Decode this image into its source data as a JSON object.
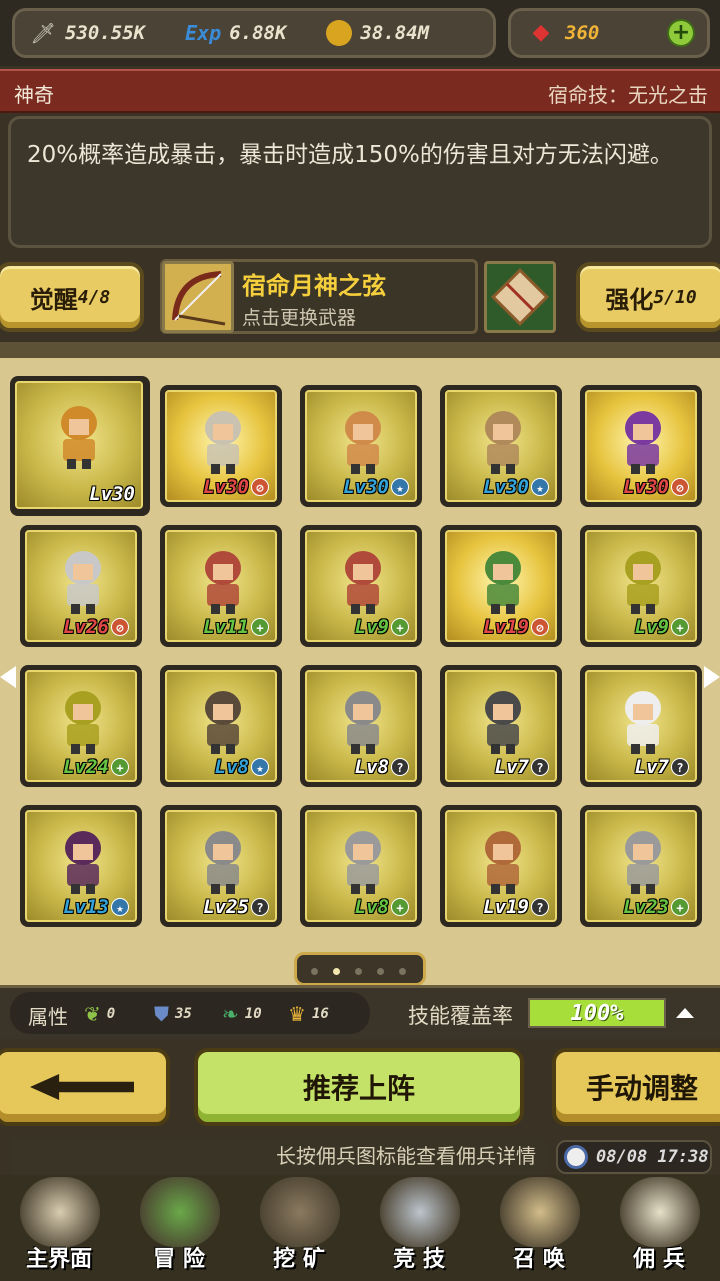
{
  "currencies": {
    "attack": {
      "icon": "sword-icon",
      "value": "530.55K"
    },
    "exp": {
      "icon": "exp-icon",
      "label": "Exp",
      "value": "6.88K"
    },
    "gold": {
      "icon": "coin-icon",
      "value": "38.84M"
    },
    "gems": {
      "icon": "ruby-icon",
      "value": "360"
    }
  },
  "title_bar": {
    "left": "神奇",
    "right": "宿命技：无光之击"
  },
  "description": "20%概率造成暴击，暴击时造成150%的伤害且对方无法闪避。",
  "weapon_row": {
    "awaken_label": "觉醒",
    "awaken_count": "4/8",
    "weapon_name": "宿命月神之弦",
    "weapon_hint": "点击更换武器",
    "enhance_label": "强化",
    "enhance_count": "5/10"
  },
  "heroes": [
    {
      "level": "Lv30",
      "color": "#ffffff",
      "badge": "",
      "selected": true,
      "tint": "#d08a2a"
    },
    {
      "level": "Lv30",
      "color": "#e04848",
      "badge": "red",
      "tint": "#c9c2b0"
    },
    {
      "level": "Lv30",
      "color": "#33a3d8",
      "badge": "blue",
      "tint": "#d08a4a"
    },
    {
      "level": "Lv30",
      "color": "#33a3d8",
      "badge": "blue",
      "tint": "#b08a5a"
    },
    {
      "level": "Lv30",
      "color": "#e04848",
      "badge": "red",
      "tint": "#7a3aa0"
    },
    {
      "level": "Lv26",
      "color": "#e04848",
      "badge": "red",
      "tint": "#c8c8c8"
    },
    {
      "level": "Lv11",
      "color": "#66c444",
      "badge": "green",
      "tint": "#b04a3a"
    },
    {
      "level": "Lv9",
      "color": "#66c444",
      "badge": "green",
      "tint": "#b04a3a"
    },
    {
      "level": "Lv19",
      "color": "#e04848",
      "badge": "red",
      "tint": "#4a8a3a"
    },
    {
      "level": "Lv9",
      "color": "#66c444",
      "badge": "green",
      "tint": "#a8a020"
    },
    {
      "level": "Lv24",
      "color": "#66c444",
      "badge": "green",
      "tint": "#a8a020"
    },
    {
      "level": "Lv8",
      "color": "#33a3d8",
      "badge": "blue",
      "tint": "#5a4a3a"
    },
    {
      "level": "Lv8",
      "color": "#ffffff",
      "badge": "grey",
      "tint": "#8a8a8a"
    },
    {
      "level": "Lv7",
      "color": "#ffffff",
      "badge": "grey",
      "tint": "#4a4a4a"
    },
    {
      "level": "Lv7",
      "color": "#ffffff",
      "badge": "grey",
      "tint": "#eeeeee"
    },
    {
      "level": "Lv13",
      "color": "#33a3d8",
      "badge": "blue",
      "tint": "#5a2a5a"
    },
    {
      "level": "Lv25",
      "color": "#ffffff",
      "badge": "grey",
      "tint": "#8a8a8a"
    },
    {
      "level": "Lv8",
      "color": "#66c444",
      "badge": "green",
      "tint": "#9a9a9a"
    },
    {
      "level": "Lv19",
      "color": "#ffffff",
      "badge": "grey",
      "tint": "#b06a3a"
    },
    {
      "level": "Lv23",
      "color": "#66c444",
      "badge": "green",
      "tint": "#9a9a9a"
    }
  ],
  "badge_symbols": {
    "red": "⊘",
    "blue": "★",
    "green": "+",
    "grey": "?"
  },
  "pagination": {
    "pages": 5,
    "current": 1
  },
  "attributes": {
    "label": "属性",
    "items": [
      {
        "icon": "nature-icon",
        "value": "0"
      },
      {
        "icon": "shield-icon",
        "value": "35"
      },
      {
        "icon": "wing-icon",
        "value": "10"
      },
      {
        "icon": "crown-icon",
        "value": "16"
      }
    ],
    "coverage_label": "技能覆盖率",
    "coverage_value": "100%",
    "coverage_fraction": 1.0
  },
  "buttons": {
    "recommend": "推荐上阵",
    "manual": "手动调整"
  },
  "tip": "长按佣兵图标能查看佣兵详情",
  "datetime": "08/08 17:38",
  "nav": [
    {
      "label": "主界面",
      "icon": "map-scroll-icon"
    },
    {
      "label": "冒 险",
      "icon": "island-icon"
    },
    {
      "label": "挖 矿",
      "icon": "pickaxe-icon"
    },
    {
      "label": "竞 技",
      "icon": "crossed-swords-icon"
    },
    {
      "label": "召 唤",
      "icon": "summon-scroll-icon"
    },
    {
      "label": "佣 兵",
      "icon": "tent-icon"
    }
  ]
}
